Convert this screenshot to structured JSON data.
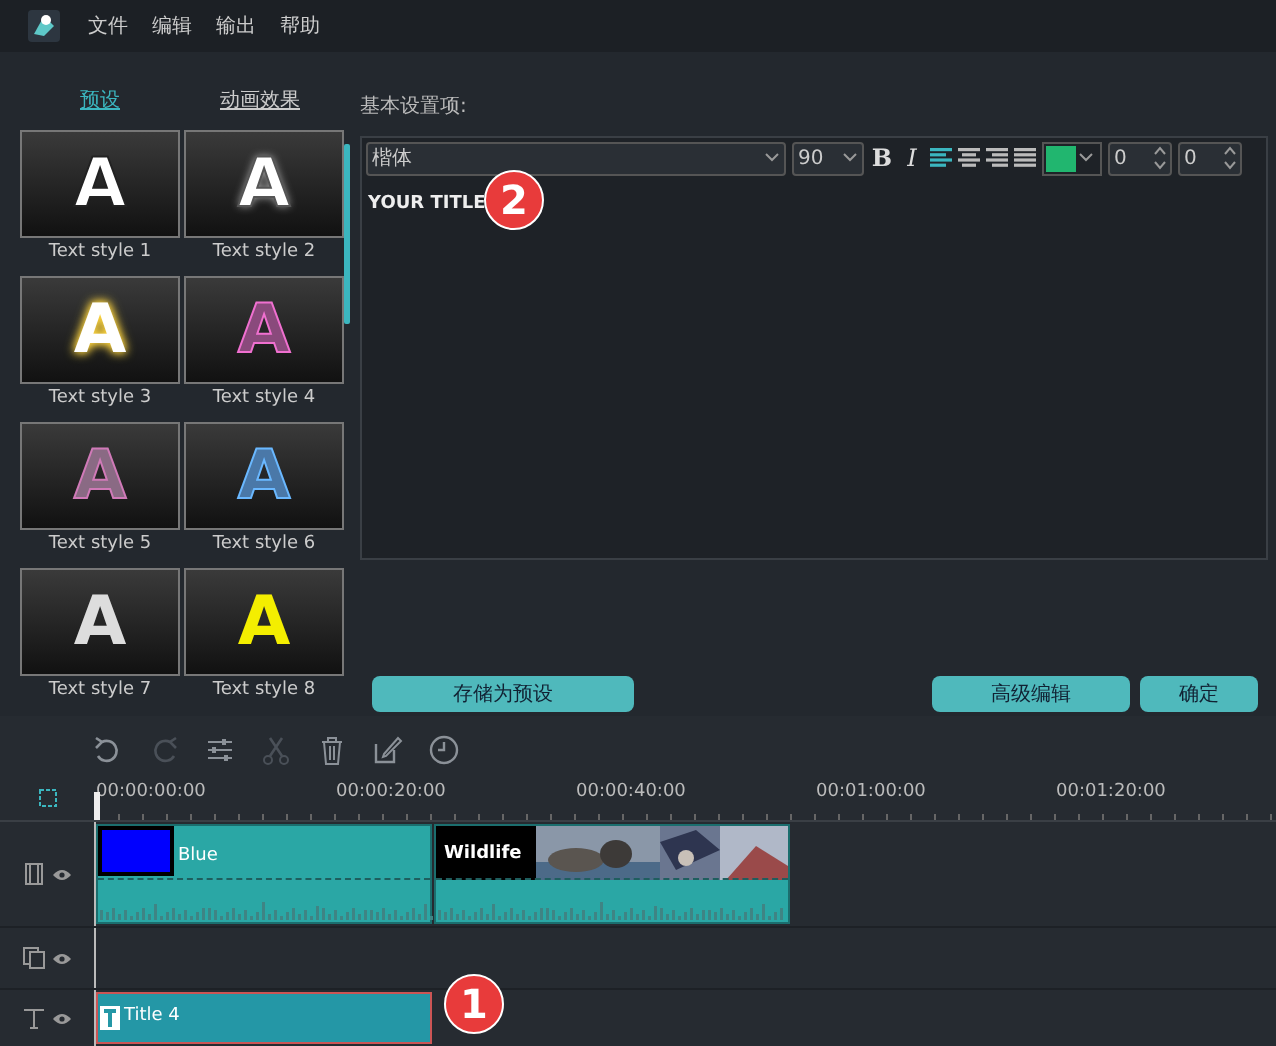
{
  "menu": {
    "items": [
      "文件",
      "编辑",
      "输出",
      "帮助"
    ]
  },
  "panel_tabs": [
    {
      "label": "预设",
      "selected": true
    },
    {
      "label": "动画效果",
      "selected": false
    }
  ],
  "text_styles": [
    {
      "letter": "A",
      "label": "Text style 1",
      "kind": "solid"
    },
    {
      "letter": "A",
      "label": "Text style 2",
      "kind": "outlined"
    },
    {
      "letter": "A",
      "label": "Text style 3",
      "kind": "glow"
    },
    {
      "letter": "A",
      "label": "Text style 4",
      "kind": "neon-pink"
    },
    {
      "letter": "A",
      "label": "Text style 5",
      "kind": "neon-dim"
    },
    {
      "letter": "A",
      "label": "Text style 6",
      "kind": "neon-blue"
    },
    {
      "letter": "A",
      "label": "Text style 7",
      "kind": "silver"
    },
    {
      "letter": "A",
      "label": "Text style 8",
      "kind": "yellow"
    }
  ],
  "editor": {
    "section_label": "基本设置项:",
    "font": "楷体",
    "size": "90",
    "bold": "B",
    "italic": "I",
    "alignments": [
      {
        "kind": "left",
        "selected": true
      },
      {
        "kind": "center",
        "selected": false
      },
      {
        "kind": "right",
        "selected": false
      },
      {
        "kind": "justify",
        "selected": false
      }
    ],
    "color_picker": {
      "color": "#21b66f"
    },
    "spin_1": "0",
    "spin_2": "0",
    "content": "YOUR TITLE"
  },
  "buttons": [
    {
      "label": "存储为预设",
      "kind": "save"
    },
    {
      "label": "高级编辑",
      "kind": "advanced"
    },
    {
      "label": "确定",
      "kind": "ok"
    }
  ],
  "timeline": {
    "tools": [
      {
        "kind": "undo",
        "disabled": false
      },
      {
        "kind": "redo",
        "disabled": true
      },
      {
        "kind": "adjust",
        "disabled": false
      },
      {
        "kind": "cut",
        "disabled": true
      },
      {
        "kind": "delete",
        "disabled": false
      },
      {
        "kind": "edit",
        "disabled": false
      },
      {
        "kind": "clock",
        "disabled": false
      }
    ],
    "ruler": [
      "00:00:00:00",
      "00:00:20:00",
      "00:00:40:00",
      "00:01:00:00",
      "00:01:20:00"
    ],
    "tracks": [
      {
        "kind": "video",
        "clips": [
          {
            "label": "Blue",
            "kind": "color"
          },
          {
            "label": "Wildlife",
            "kind": "footage"
          }
        ]
      },
      {
        "kind": "overlay"
      },
      {
        "kind": "title",
        "clips": [
          {
            "label": "Title 4",
            "kind": "title"
          }
        ]
      }
    ]
  },
  "callouts": [
    {
      "text": "2",
      "kind": "editor"
    },
    {
      "text": "1",
      "kind": "timeline"
    }
  ]
}
